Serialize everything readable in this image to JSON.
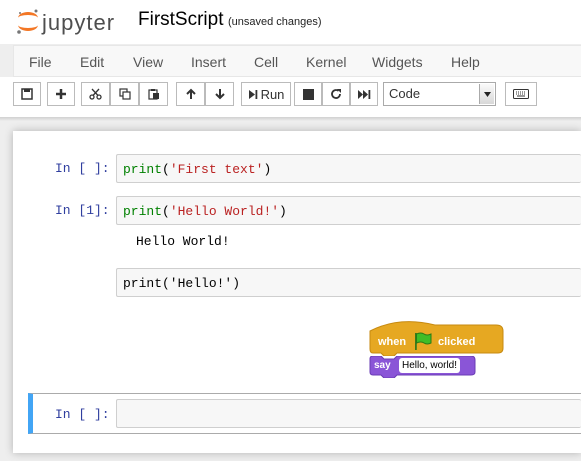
{
  "header": {
    "logo_text": "jupyter",
    "notebook_title": "FirstScript",
    "save_status": "(unsaved changes)"
  },
  "menubar": {
    "items": [
      "File",
      "Edit",
      "View",
      "Insert",
      "Cell",
      "Kernel",
      "Widgets",
      "Help"
    ]
  },
  "toolbar": {
    "buttons": [
      "save-icon",
      "plus-icon",
      "cut-icon",
      "copy-icon",
      "paste-icon",
      "arrow-up-icon",
      "arrow-down-icon",
      "run-icon",
      "stop-icon",
      "restart-icon",
      "fast-forward-icon",
      "keyboard-icon"
    ],
    "run_label": "Run",
    "cell_type": "Code"
  },
  "cells": [
    {
      "prompt": "In [ ]:",
      "code_fn": "print",
      "code_open": "(",
      "code_str": "'First text'",
      "code_close": ")"
    },
    {
      "prompt": "In [1]:",
      "code_fn": "print",
      "code_open": "(",
      "code_str": "'Hello World!'",
      "code_close": ")",
      "output": "Hello World!"
    },
    {
      "code": "print('Hello!')"
    },
    {
      "prompt": "In [ ]:",
      "code": ""
    }
  ],
  "scratch_blocks": {
    "hat_label_when": "when",
    "hat_label_clicked": "clicked",
    "flag_icon": "green-flag-icon",
    "say_label": "say",
    "say_value": "Hello, world!",
    "events_color": "#e6a822",
    "looks_color": "#8a55d7"
  },
  "colors": {
    "prompt": "#303f9f",
    "keyword": "#008000",
    "string": "#ba2121",
    "selected_border": "#42a5f5"
  }
}
